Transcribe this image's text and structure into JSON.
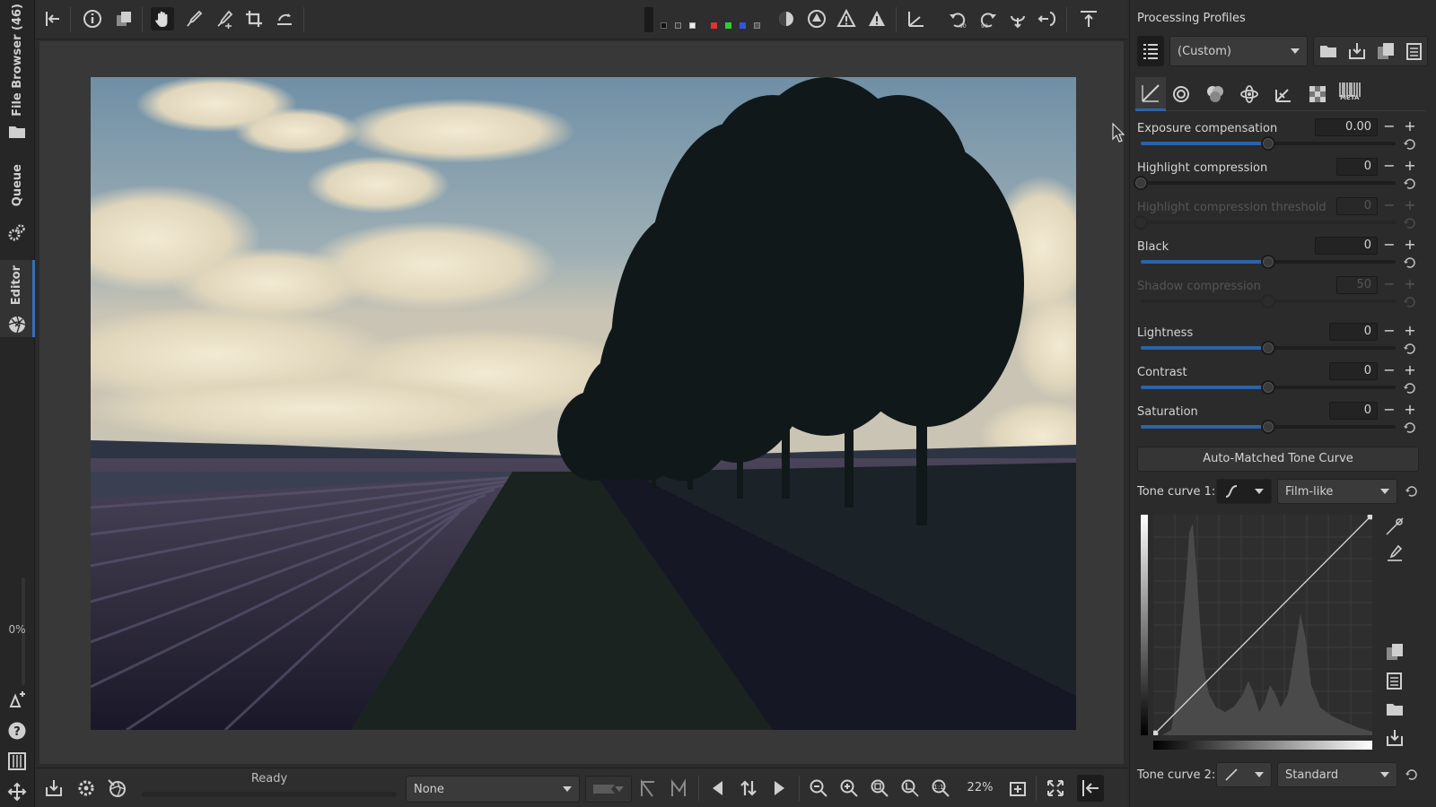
{
  "left_tabs": {
    "file_browser": "File Browser (46)",
    "queue": "Queue",
    "editor": "Editor",
    "progress": "0%"
  },
  "statusbar": {
    "status": "Ready",
    "profile_combo": "None",
    "zoom": "22%"
  },
  "panel": {
    "title": "Processing Profiles",
    "profile": "(Custom)",
    "sliders": [
      {
        "label": "Exposure compensation",
        "value": "0.00",
        "position": 0.5,
        "enabled": true
      },
      {
        "label": "Highlight compression",
        "value": "0",
        "position": 0.0,
        "enabled": true
      },
      {
        "label": "Highlight compression threshold",
        "value": "0",
        "position": 0.0,
        "enabled": false
      },
      {
        "label": "Black",
        "value": "0",
        "position": 0.5,
        "enabled": true
      },
      {
        "label": "Shadow compression",
        "value": "50",
        "position": 0.5,
        "enabled": false
      },
      {
        "label": "Lightness",
        "value": "0",
        "position": 0.5,
        "enabled": true
      },
      {
        "label": "Contrast",
        "value": "0",
        "position": 0.5,
        "enabled": true
      },
      {
        "label": "Saturation",
        "value": "0",
        "position": 0.5,
        "enabled": true
      }
    ],
    "auto_tone_button": "Auto-Matched Tone Curve",
    "tone_curve_1_label": "Tone curve 1:",
    "tone_curve_1_mode": "Film-like",
    "tone_curve_2_label": "Tone curve 2:",
    "tone_curve_2_mode": "Standard",
    "meta_tab": "META"
  },
  "colors": {
    "accent": "#2d63a8",
    "background": "#2b2b2b",
    "viewer": "#383838"
  }
}
